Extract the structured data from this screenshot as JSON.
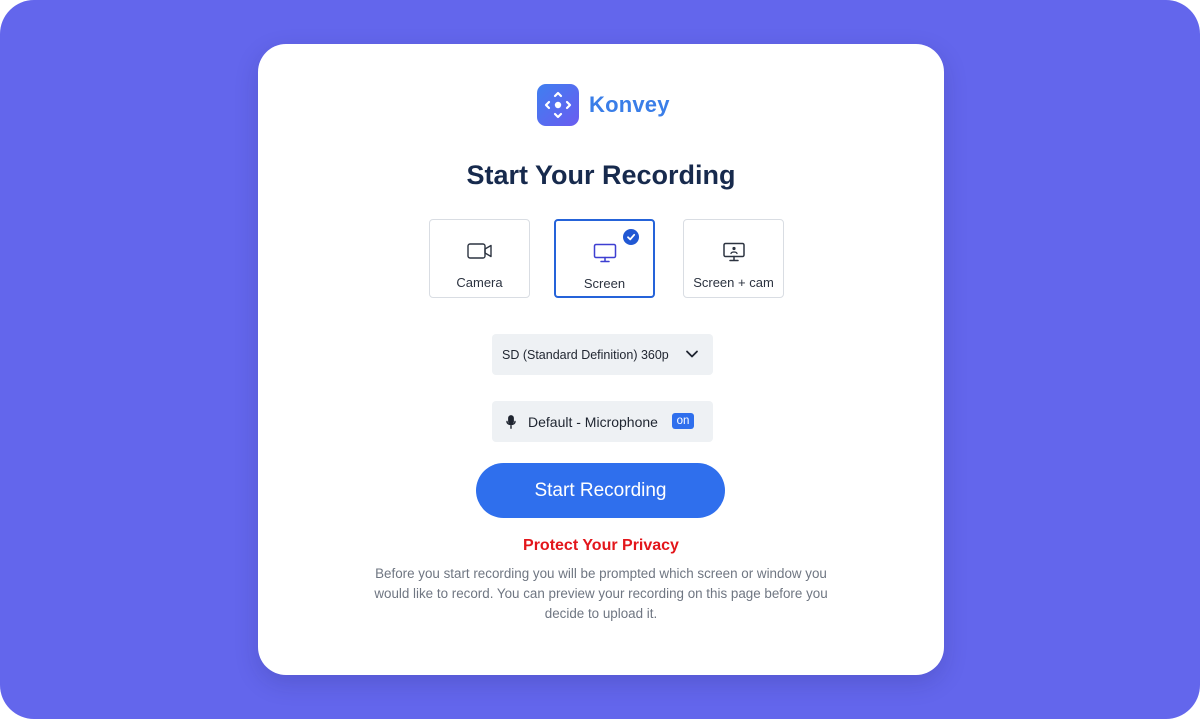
{
  "app": {
    "brand_name": "Konvey",
    "accent_color": "#2f6fed",
    "background_color": "#6366ec"
  },
  "header": {
    "title": "Start Your Recording"
  },
  "modes": [
    {
      "label": "Camera",
      "icon": "video-camera-icon",
      "selected": false
    },
    {
      "label": "Screen",
      "icon": "monitor-icon",
      "selected": true
    },
    {
      "label": "Screen + cam",
      "icon": "screen-cam-icon",
      "selected": false
    }
  ],
  "quality_select": {
    "selected": "SD (Standard Definition) 360p",
    "icon": "chevron-down-icon"
  },
  "microphone": {
    "label": "Default - Microphone",
    "status": "on",
    "icon": "microphone-icon"
  },
  "actions": {
    "start_label": "Start Recording"
  },
  "privacy": {
    "title": "Protect Your Privacy",
    "text": "Before you start recording you will be prompted which screen or window you would like to record. You can preview your recording on this page before you decide to upload it.",
    "title_color": "#e3161b"
  }
}
